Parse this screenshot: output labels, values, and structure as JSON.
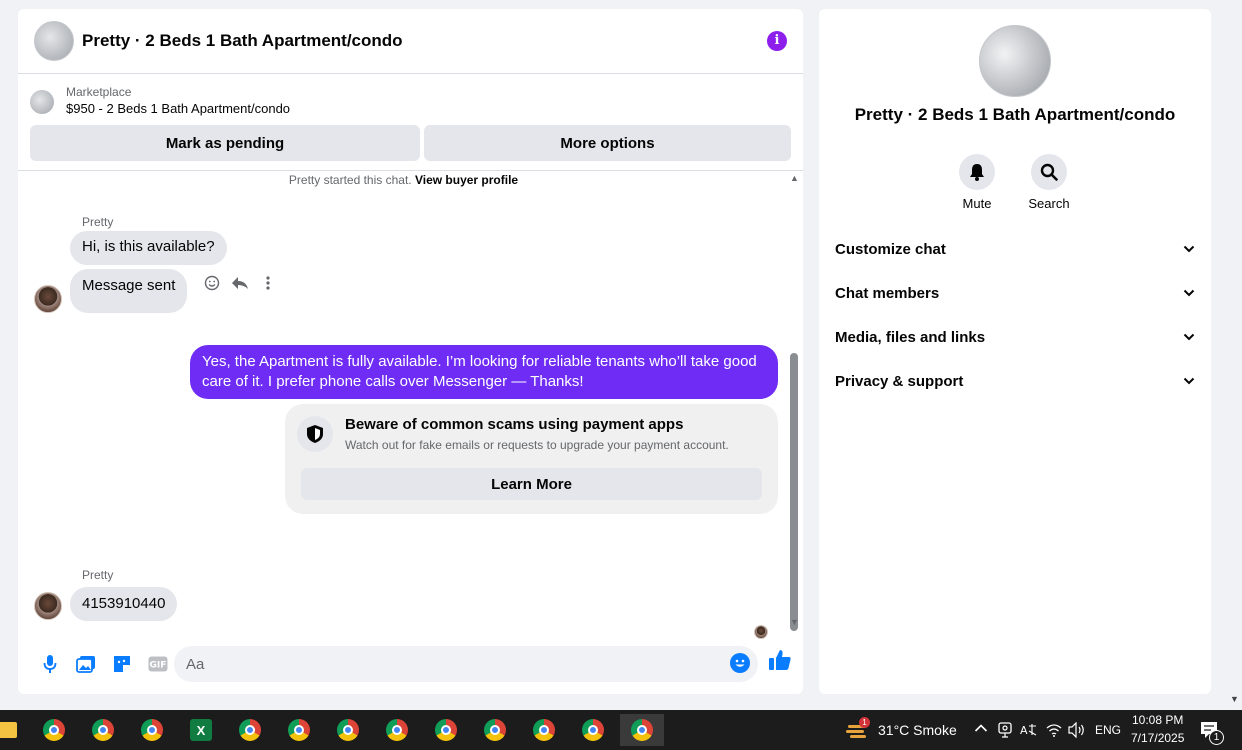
{
  "chat": {
    "title": "Pretty · 2 Beds 1 Bath Apartment/condo",
    "listing": {
      "source": "Marketplace",
      "name": "$950 - 2 Beds 1 Bath Apartment/condo",
      "mark_pending": "Mark as pending",
      "more_options": "More options"
    },
    "intro_text": "Pretty started this chat.",
    "intro_link": "View buyer profile",
    "messages": {
      "sender1": "Pretty",
      "msg1": "Hi, is this available?",
      "msg2": "Message sent",
      "out": "Yes, the Apartment is fully available. I’m looking for reliable tenants who’ll take good care of it. I prefer phone calls over Messenger —  Thanks!",
      "scam_title": "Beware of common scams using payment apps",
      "scam_desc": "Watch out for fake emails or requests to upgrade your payment account.",
      "learn_more": "Learn More",
      "sender2": "Pretty",
      "msg3": "4153910440"
    },
    "composer_placeholder": "Aa"
  },
  "details": {
    "title": "Pretty · 2 Beds 1 Bath Apartment/condo",
    "mute": "Mute",
    "search": "Search",
    "sections": [
      "Customize chat",
      "Chat members",
      "Media, files and links",
      "Privacy & support"
    ]
  },
  "taskbar": {
    "weather": "31°C  Smoke",
    "weather_badge": "1",
    "lang": "ENG",
    "time": "10:08 PM",
    "date": "7/17/2025",
    "notif_count": "1"
  },
  "colors": {
    "accent": "#8e1eec",
    "outgoing_bubble": "#6f2cf4",
    "messenger_blue": "#0a7cff"
  }
}
